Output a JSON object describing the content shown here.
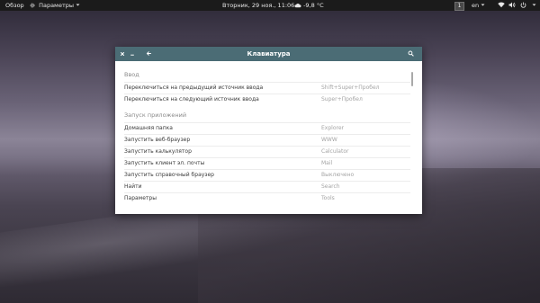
{
  "topbar": {
    "overview": "Обзор",
    "app_menu": "Параметры",
    "clock": "Вторник, 29 ноя., 11:06",
    "weather": "-9,8 °C",
    "workspace": "1",
    "lang": "en",
    "icons": [
      "gear-icon",
      "chevron-down-icon",
      "cloud-icon",
      "wifi-icon",
      "volume-icon",
      "power-icon"
    ]
  },
  "window": {
    "title": "Клавиатура",
    "icons": [
      "close-icon",
      "minimize-icon",
      "back-arrow-icon",
      "search-icon"
    ],
    "sections": [
      {
        "title": "Ввод",
        "rows": [
          {
            "action": "Переключиться на предыдущий источник ввода",
            "shortcut": "Shift+Super+Пробел"
          },
          {
            "action": "Переключиться на следующий источник ввода",
            "shortcut": "Super+Пробел"
          }
        ]
      },
      {
        "title": "Запуск приложений",
        "rows": [
          {
            "action": "Домашняя папка",
            "shortcut": "Explorer"
          },
          {
            "action": "Запустить веб-браузер",
            "shortcut": "WWW"
          },
          {
            "action": "Запустить калькулятор",
            "shortcut": "Calculator"
          },
          {
            "action": "Запустить клиент эл. почты",
            "shortcut": "Mail"
          },
          {
            "action": "Запустить справочный браузер",
            "shortcut": "Выключено"
          },
          {
            "action": "Найти",
            "shortcut": "Search"
          },
          {
            "action": "Параметры",
            "shortcut": "Tools"
          }
        ]
      }
    ]
  }
}
